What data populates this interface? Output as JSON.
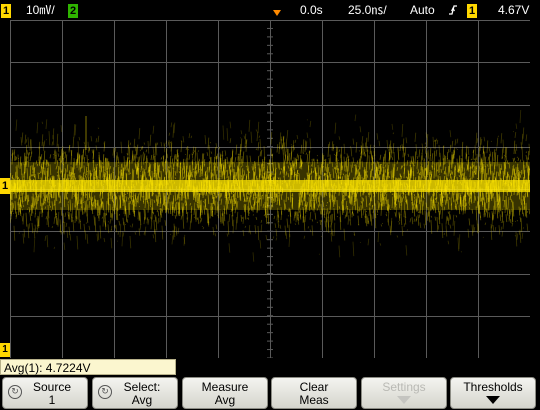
{
  "topbar": {
    "channel1_label": "1",
    "channel1_scale": "10㎷/",
    "channel2_label": "2",
    "time_offset": "0.0s",
    "timebase": "25.0㎱/",
    "trigger_mode": "Auto",
    "trigger_slope_icon": "rising-edge-icon",
    "trigger_source": "1",
    "trigger_level": "4.67V"
  },
  "screen": {
    "channel_marker": "1",
    "ground_marker": "1",
    "trace_color": "#ffe600"
  },
  "readout": {
    "text": "Avg(1): 4.7224V"
  },
  "softkeys": [
    {
      "line1": "Source",
      "line2": "1",
      "icon": "rotate-knob-icon",
      "enabled": true
    },
    {
      "line1": "Select:",
      "line2": "Avg",
      "icon": "rotate-knob-icon",
      "enabled": true
    },
    {
      "line1": "Measure",
      "line2": "Avg",
      "enabled": true
    },
    {
      "line1": "Clear",
      "line2": "Meas",
      "enabled": true
    },
    {
      "line1": "Settings",
      "line2": "",
      "enabled": false
    },
    {
      "line1": "Thresholds",
      "line2": "",
      "enabled": true
    }
  ],
  "colors": {
    "channel1": "#ffd800",
    "channel2": "#2fb400",
    "grid": "#5a5a5a"
  }
}
